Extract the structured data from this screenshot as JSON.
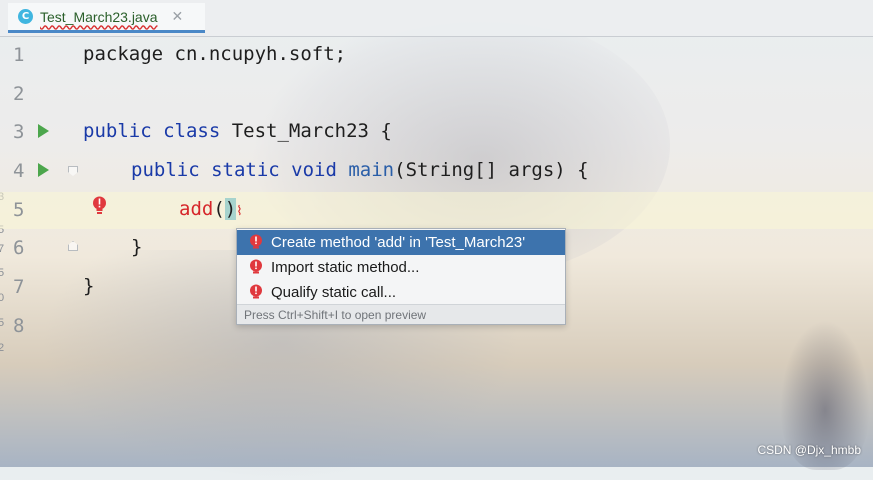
{
  "tab": {
    "icon_letter": "C",
    "label": "Test_March23.java",
    "close_glyph": "✕"
  },
  "edge_numbers": [
    "3",
    "5",
    "7",
    "5",
    "0",
    "5",
    "2"
  ],
  "lines": [
    {
      "num": "1",
      "code": "package cn.ncupyh.soft;"
    },
    {
      "num": "2",
      "code": ""
    },
    {
      "num": "3",
      "kw1": "public class",
      "rest": " Test_March23 {"
    },
    {
      "num": "4",
      "kw1": "public static void",
      "fn": "main",
      "rest": "(String[] args) {"
    },
    {
      "num": "5",
      "err": "add",
      "paren_open": "(",
      "paren_close": ")"
    },
    {
      "num": "6",
      "code": "}"
    },
    {
      "num": "7",
      "code": "}"
    },
    {
      "num": "8",
      "code": ""
    }
  ],
  "popup": {
    "items": [
      {
        "label": "Create method 'add' in 'Test_March23'",
        "selected": true
      },
      {
        "label": "Import static method...",
        "selected": false
      },
      {
        "label": "Qualify static call...",
        "selected": false
      }
    ],
    "footer": "Press Ctrl+Shift+I to open preview"
  },
  "watermark": "CSDN @Djx_hmbb",
  "colors": {
    "keyword": "#1a3aa8",
    "error": "#d6262a",
    "selection": "#3d73ad",
    "run_icon": "#4ca64c"
  }
}
